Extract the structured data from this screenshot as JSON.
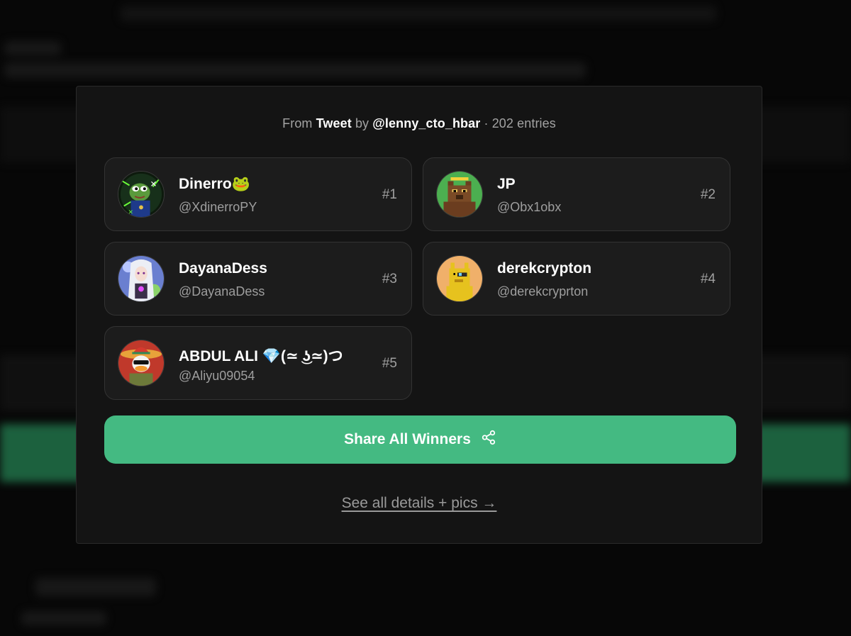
{
  "header": {
    "prefix": "From",
    "source": "Tweet",
    "by": "by",
    "author": "@lenny_cto_hbar",
    "separator": "·",
    "entries": "202 entries"
  },
  "winners": [
    {
      "name": "Dinerro🐸",
      "handle": "@XdinerroPY",
      "rank": "#1",
      "avatar": "pepe-avatar-icon"
    },
    {
      "name": "JP",
      "handle": "@Obx1obx",
      "rank": "#2",
      "avatar": "pixel-bear-avatar-icon"
    },
    {
      "name": "DayanaDess",
      "handle": "@DayanaDess",
      "rank": "#3",
      "avatar": "anime-girl-avatar-icon"
    },
    {
      "name": "derekcrypton",
      "handle": "@derekcryprton",
      "rank": "#4",
      "avatar": "pixel-dog-avatar-icon"
    },
    {
      "name": "ABDUL ALI 💎(≃ ͜ʖ≃)つ",
      "handle": "@Aliyu09054",
      "rank": "#5",
      "avatar": "duck-sombrero-avatar-icon"
    }
  ],
  "share_button": {
    "label": "Share All Winners",
    "icon": "share-icon"
  },
  "details_link": {
    "label": "See all details + pics →"
  },
  "colors": {
    "accent": "#44ba82",
    "card_bg": "#1c1c1c",
    "modal_bg": "#141414"
  }
}
